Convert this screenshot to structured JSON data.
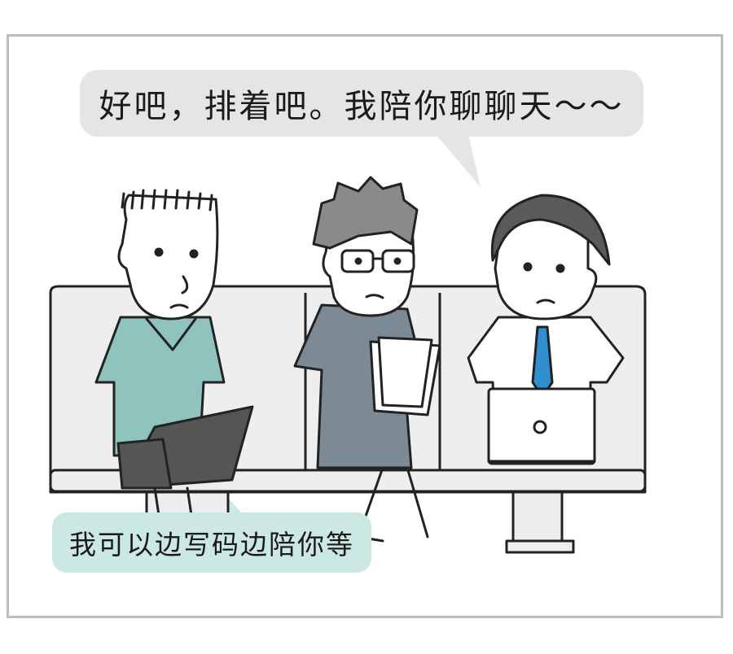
{
  "colors": {
    "frame": "#bdbdbd",
    "bubble_top": "#e5e5e5",
    "bubble_bottom": "#cbe8e3",
    "bench": "#eeeeee",
    "shirt_plaid": "#8fc3bd",
    "shirt_grey": "#7c8a96",
    "laptop": "#555555",
    "tie": "#2f8fcf"
  },
  "dialogue": {
    "top": "好吧，排着吧。我陪你聊聊天～～",
    "bottom": "我可以边写码边陪你等"
  },
  "icons": [
    "laptop-icon",
    "paper-icon",
    "bench-icon"
  ]
}
